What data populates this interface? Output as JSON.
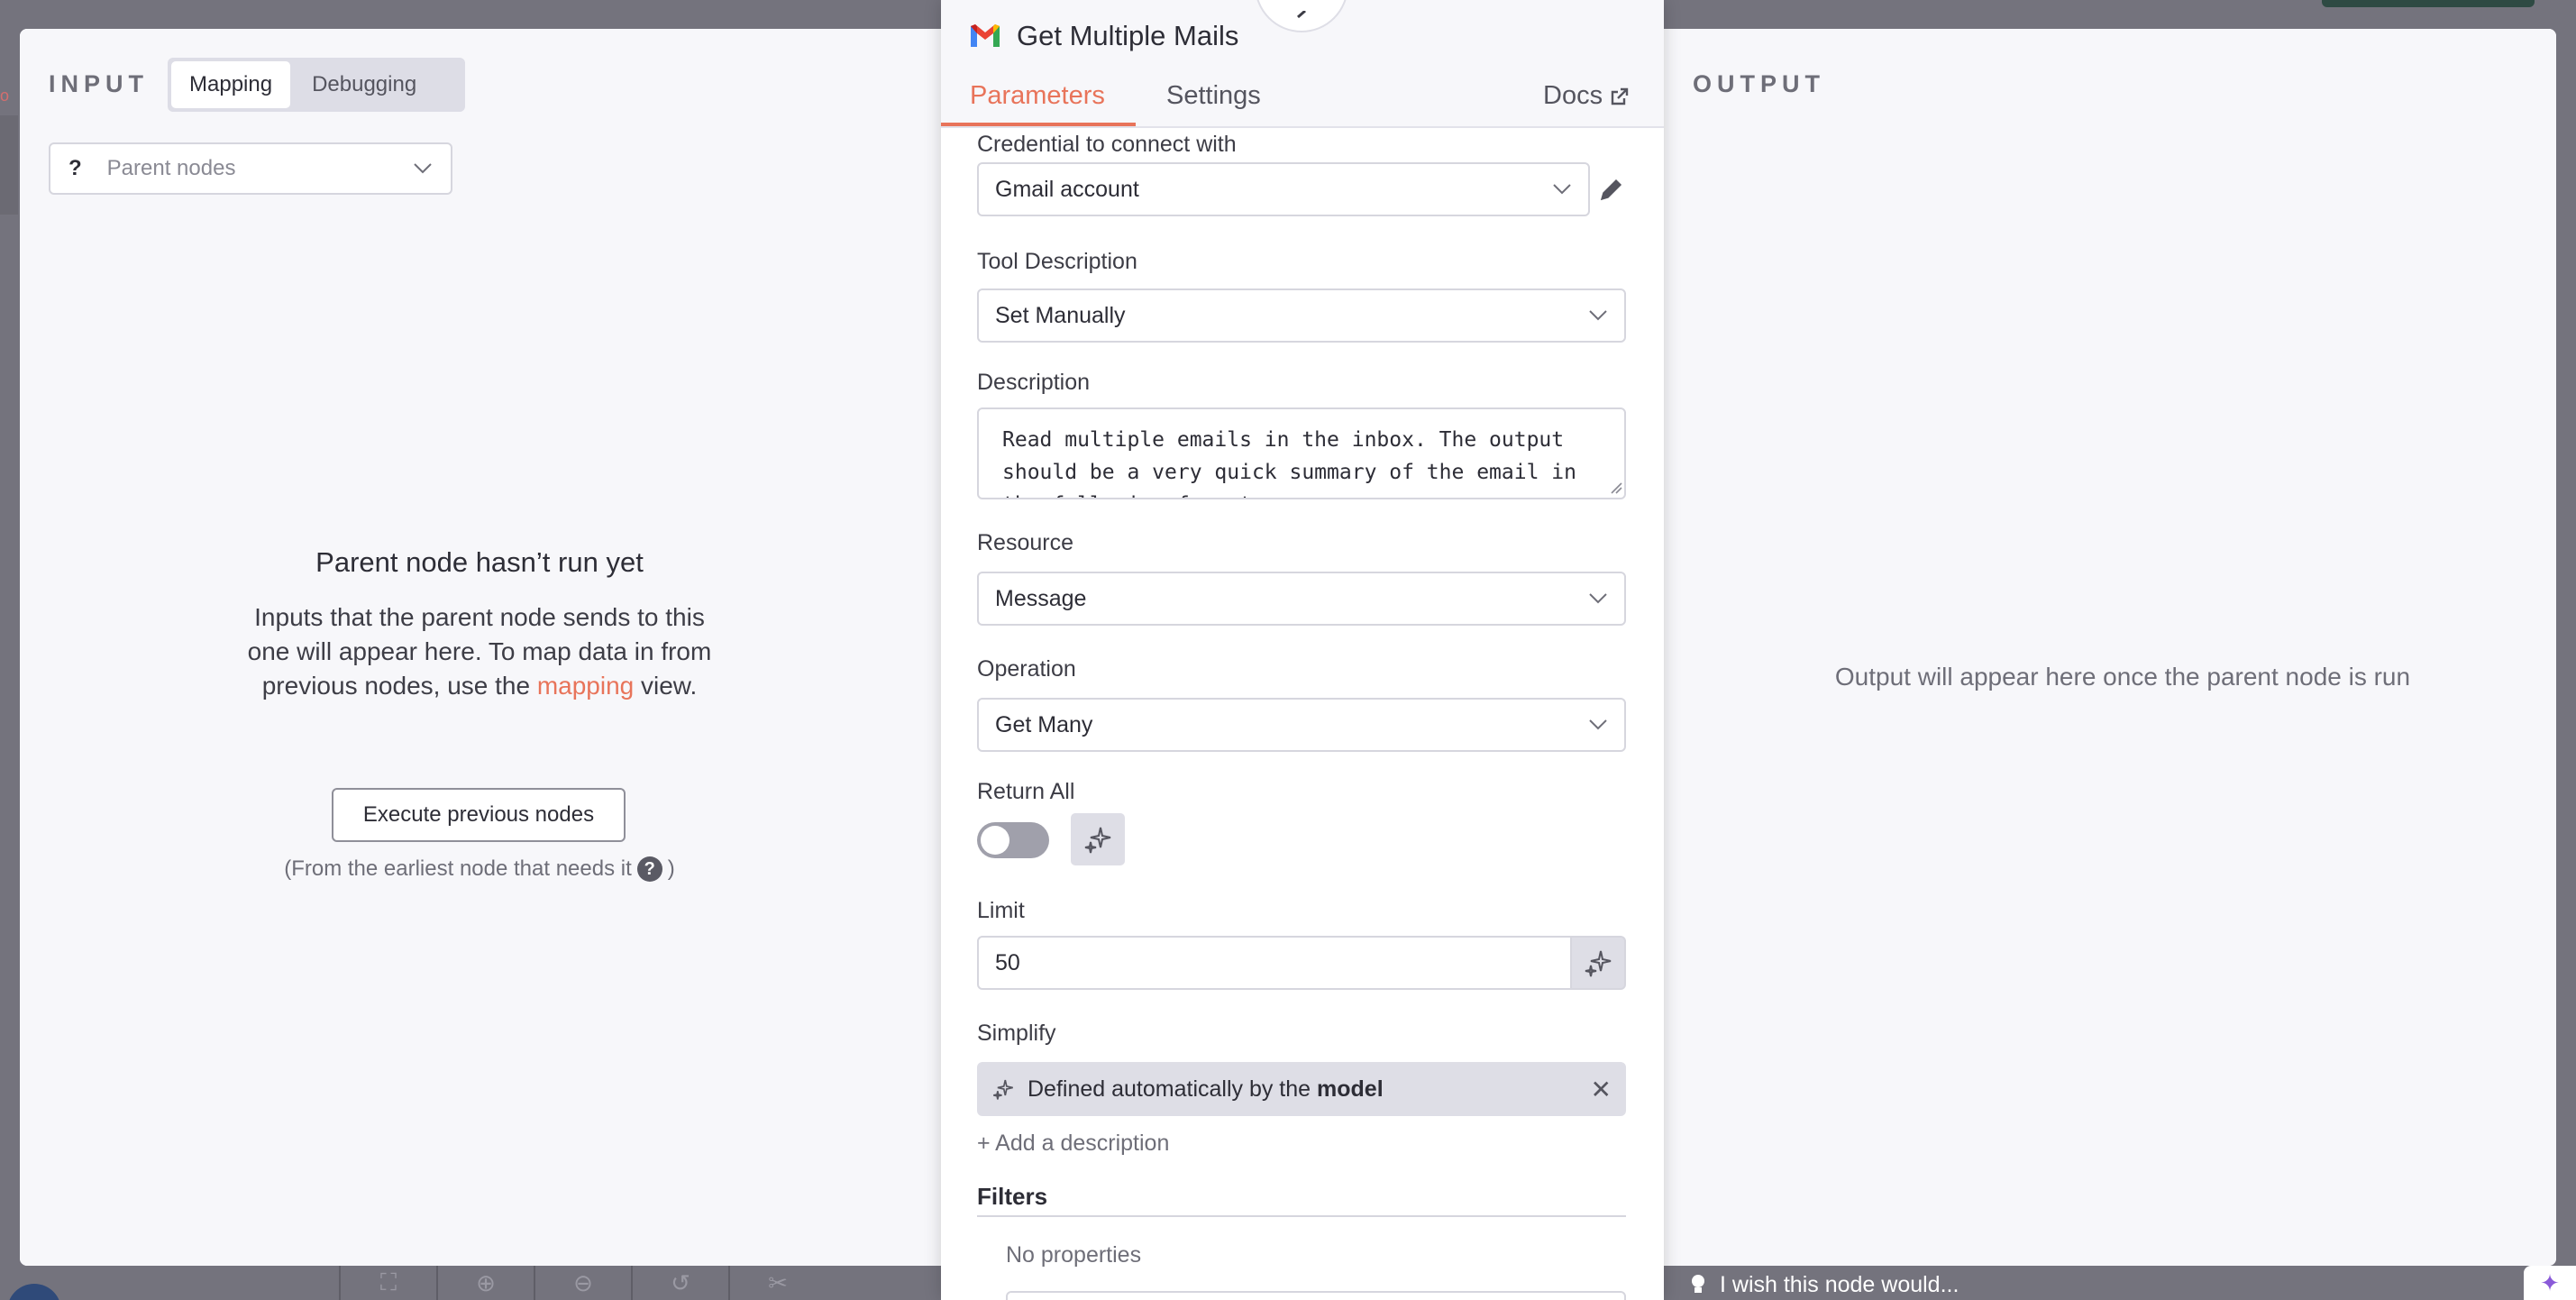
{
  "input_panel": {
    "label": "INPUT",
    "tabs": [
      {
        "label": "Mapping",
        "active": true
      },
      {
        "label": "Debugging",
        "active": false
      }
    ],
    "parent_select": {
      "icon": "?",
      "placeholder": "Parent nodes"
    },
    "empty_title": "Parent node hasn’t run yet",
    "empty_body_pre": "Inputs that the parent node sends to this one will appear here. To map data in from previous nodes, use the",
    "empty_body_link": "mapping",
    "empty_body_post": "view.",
    "execute_button": "Execute previous nodes",
    "execute_note_pre": "(From the earliest node that needs it",
    "execute_note_post": ")"
  },
  "output_panel": {
    "label": "OUTPUT",
    "message": "Output will appear here once the parent node is run"
  },
  "node": {
    "title": "Get Multiple Mails",
    "icon": "gmail-icon",
    "tabs": [
      {
        "label": "Parameters",
        "active": true
      },
      {
        "label": "Settings",
        "active": false
      }
    ],
    "docs_label": "Docs"
  },
  "params": {
    "credential": {
      "label": "Credential to connect with",
      "value": "Gmail account"
    },
    "tool_description": {
      "label": "Tool Description",
      "value": "Set Manually"
    },
    "description": {
      "label": "Description",
      "value": "Read multiple emails in the inbox. The output should be a very quick summary of the email in the following format"
    },
    "resource": {
      "label": "Resource",
      "value": "Message"
    },
    "operation": {
      "label": "Operation",
      "value": "Get Many"
    },
    "return_all": {
      "label": "Return All",
      "enabled": false
    },
    "limit": {
      "label": "Limit",
      "value": "50"
    },
    "simplify": {
      "label": "Simplify",
      "auto_text": "Defined automatically by the",
      "auto_bold": "model"
    },
    "add_description": "+ Add a description",
    "filters": {
      "label": "Filters",
      "empty": "No properties"
    }
  },
  "footer": {
    "wish_text": "I wish this node would..."
  },
  "colors": {
    "accent": "#e8745a",
    "overlay": "#74737d",
    "panel_bg": "#f7f7fa"
  }
}
